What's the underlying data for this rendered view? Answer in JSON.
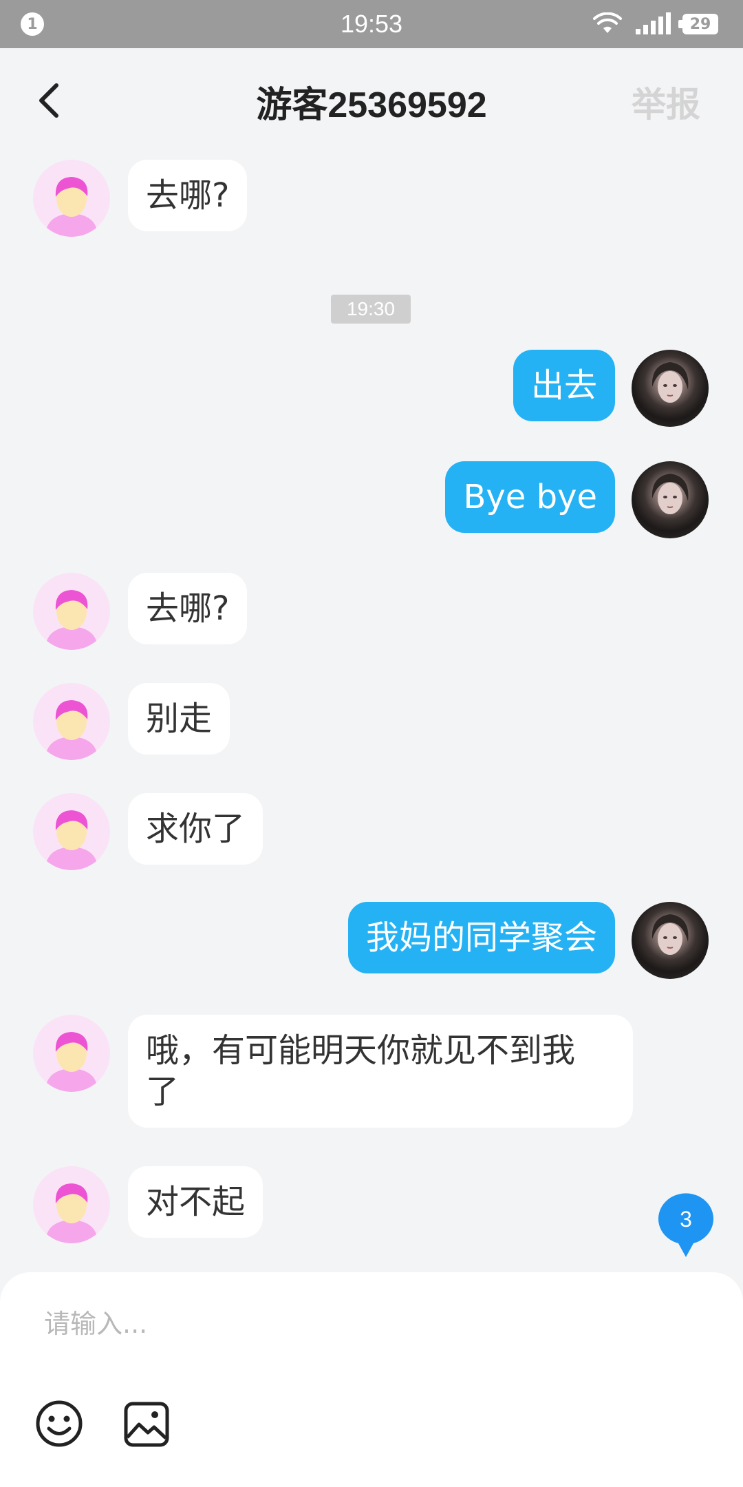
{
  "status_bar": {
    "notification_count": "1",
    "time": "19:53",
    "battery": "29",
    "icons": [
      "wifi-icon",
      "signal-icon",
      "battery-icon"
    ]
  },
  "header": {
    "title": "游客25369592",
    "report_label": "举报",
    "back_icon": "chevron-left-icon"
  },
  "messages": {
    "m1": {
      "sender": "other",
      "text": "去哪?"
    },
    "divider_time": "19:30",
    "m2": {
      "sender": "self",
      "text": "出去"
    },
    "m3": {
      "sender": "self",
      "text": "Bye bye"
    },
    "m4": {
      "sender": "other",
      "text": "去哪?"
    },
    "m5": {
      "sender": "other",
      "text": "别走"
    },
    "m6": {
      "sender": "other",
      "text": "求你了"
    },
    "m7": {
      "sender": "self",
      "text": "我妈的同学聚会"
    },
    "m8": {
      "sender": "other",
      "text": "哦，有可能明天你就见不到我\n了"
    },
    "m9": {
      "sender": "other",
      "text": "对不起"
    }
  },
  "unread_count": "3",
  "composer": {
    "placeholder": "请输入...",
    "value": "",
    "icons": [
      "emoji-icon",
      "image-icon"
    ]
  },
  "colors": {
    "outgoing_bubble": "#25b2f4",
    "incoming_bubble": "#ffffff",
    "background": "#f3f4f6",
    "status_bar": "#9b9b9b",
    "unread_badge": "#1e95f2"
  }
}
